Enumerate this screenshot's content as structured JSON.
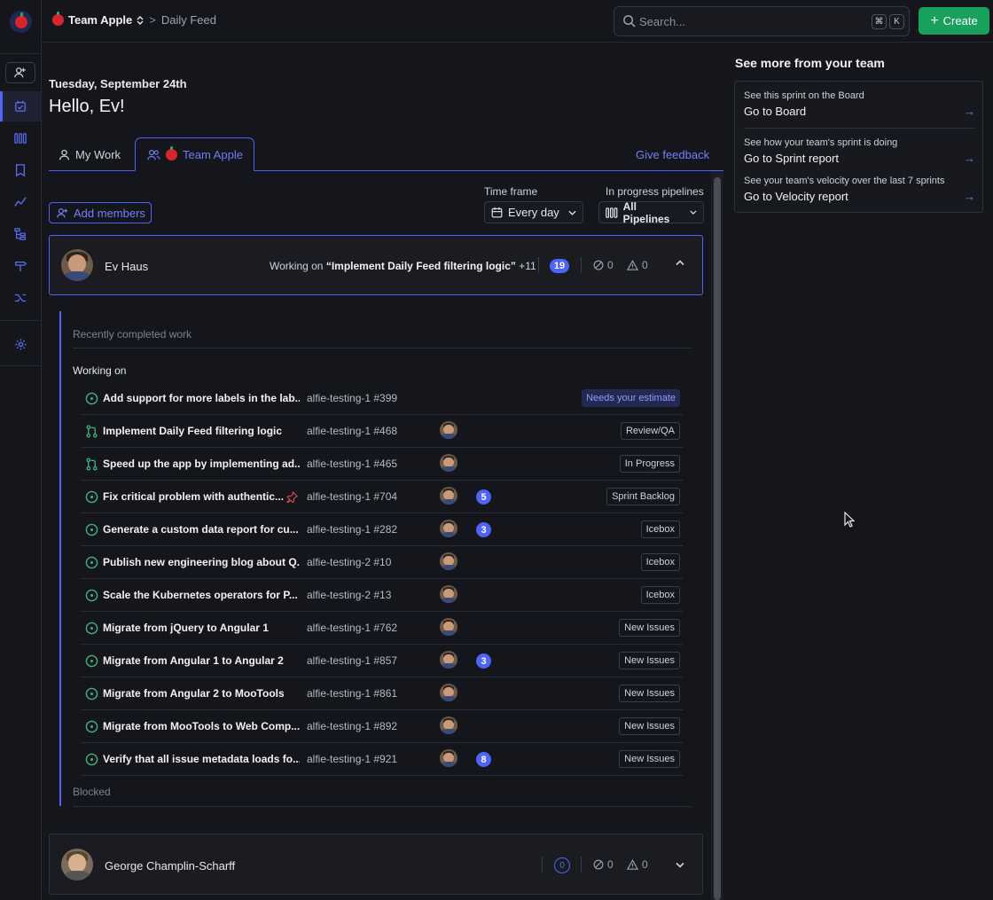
{
  "topbar": {
    "team": "Team Apple",
    "separator": ">",
    "page": "Daily Feed",
    "search_placeholder": "Search...",
    "shortcut_cmd": "⌘",
    "shortcut_key": "K",
    "create_label": "Create"
  },
  "greeting": {
    "date": "Tuesday, September 24th",
    "hello": "Hello, Ev!"
  },
  "tabs": {
    "my_work": "My Work",
    "team": "Team Apple",
    "feedback": "Give feedback"
  },
  "filters": {
    "add_members": "Add members",
    "timeframe_label": "Time frame",
    "timeframe_value": "Every day",
    "pipelines_label": "In progress pipelines",
    "pipelines_value": "All Pipelines"
  },
  "members": [
    {
      "name": "Ev Haus",
      "working_prefix": "Working on",
      "working_item": "“Implement Daily Feed filtering logic”",
      "working_more": "+11",
      "count": "19",
      "blocked": "0",
      "warnings": "0"
    },
    {
      "name": "George Champlin-Scharff",
      "count": "0",
      "blocked": "0",
      "warnings": "0"
    }
  ],
  "sections": {
    "recent": "Recently completed work",
    "working": "Working on",
    "blocked": "Blocked"
  },
  "issues": [
    {
      "type": "issue",
      "title": "Add support for more labels in the lab...",
      "repo": "alfie-testing-1 #399",
      "avatar": false,
      "estimate": "",
      "status": "Needs your estimate",
      "pinned": false
    },
    {
      "type": "pr",
      "title": "Implement Daily Feed filtering logic",
      "repo": "alfie-testing-1 #468",
      "avatar": true,
      "estimate": "",
      "status": "Review/QA",
      "pinned": false
    },
    {
      "type": "pr",
      "title": "Speed up the app by implementing ad...",
      "repo": "alfie-testing-1 #465",
      "avatar": true,
      "estimate": "",
      "status": "In Progress",
      "pinned": false
    },
    {
      "type": "issue",
      "title": "Fix critical problem with authentic...",
      "repo": "alfie-testing-1 #704",
      "avatar": true,
      "estimate": "5",
      "status": "Sprint Backlog",
      "pinned": true
    },
    {
      "type": "issue",
      "title": "Generate a custom data report for cu...",
      "repo": "alfie-testing-1 #282",
      "avatar": true,
      "estimate": "3",
      "status": "Icebox",
      "pinned": false
    },
    {
      "type": "issue",
      "title": "Publish new engineering blog about Q...",
      "repo": "alfie-testing-2 #10",
      "avatar": true,
      "estimate": "",
      "status": "Icebox",
      "pinned": false
    },
    {
      "type": "issue",
      "title": "Scale the Kubernetes operators for P...",
      "repo": "alfie-testing-2 #13",
      "avatar": true,
      "estimate": "",
      "status": "Icebox",
      "pinned": false
    },
    {
      "type": "issue",
      "title": "Migrate from jQuery to Angular 1",
      "repo": "alfie-testing-1 #762",
      "avatar": true,
      "estimate": "",
      "status": "New Issues",
      "pinned": false
    },
    {
      "type": "issue",
      "title": "Migrate from Angular 1 to Angular 2",
      "repo": "alfie-testing-1 #857",
      "avatar": true,
      "estimate": "3",
      "status": "New Issues",
      "pinned": false
    },
    {
      "type": "issue",
      "title": "Migrate from Angular 2 to MooTools",
      "repo": "alfie-testing-1 #861",
      "avatar": true,
      "estimate": "",
      "status": "New Issues",
      "pinned": false
    },
    {
      "type": "issue",
      "title": "Migrate from MooTools to Web Comp...",
      "repo": "alfie-testing-1 #892",
      "avatar": true,
      "estimate": "",
      "status": "New Issues",
      "pinned": false
    },
    {
      "type": "issue",
      "title": "Verify that all issue metadata loads fo...",
      "repo": "alfie-testing-1 #921",
      "avatar": true,
      "estimate": "8",
      "status": "New Issues",
      "pinned": false
    }
  ],
  "right_panel": {
    "title": "See more from your team",
    "items": [
      {
        "hint": "See this sprint on the Board",
        "link": "Go to Board"
      },
      {
        "hint": "See how your team's sprint is doing",
        "link": "Go to Sprint report"
      },
      {
        "hint": "See your team's velocity over the last 7 sprints",
        "link": "Go to Velocity report"
      }
    ]
  },
  "colors": {
    "accent": "#4f64f6",
    "create_green": "#18a05c",
    "issue_green": "#3fb27f",
    "background": "#14161c"
  },
  "icons": {
    "rail": [
      "zenhub-logo",
      "invite-user-icon",
      "daily-feed-icon",
      "board-icon",
      "roadmap-icon",
      "reports-icon",
      "workspace-tree-icon",
      "signpost-icon",
      "pipelines-icon",
      "settings-icon"
    ]
  }
}
